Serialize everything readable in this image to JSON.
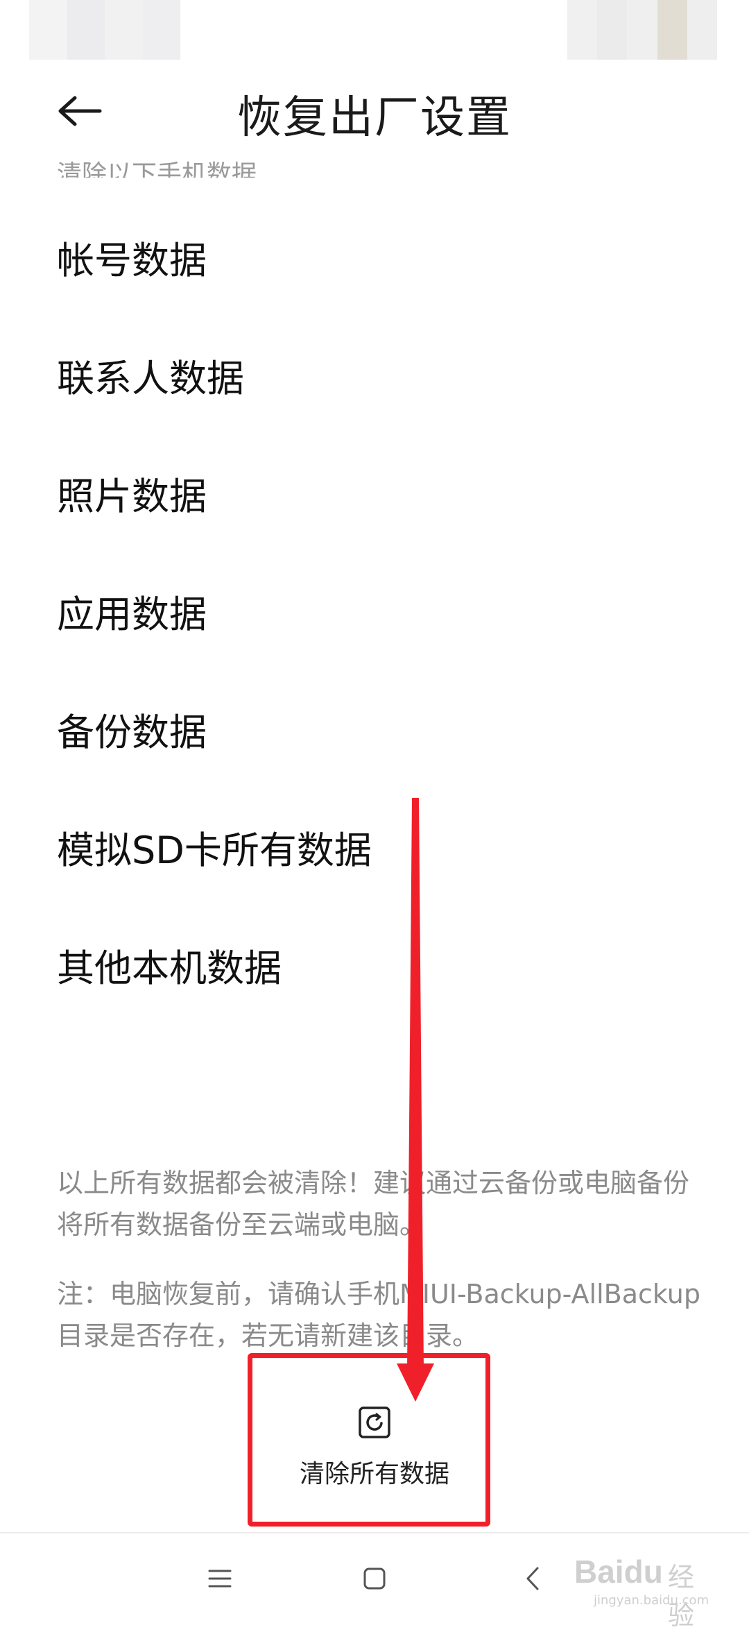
{
  "header": {
    "title": "恢复出厂设置",
    "partial_subtitle": "清除以下手机数据"
  },
  "list": {
    "items": [
      {
        "label": "帐号数据"
      },
      {
        "label": "联系人数据"
      },
      {
        "label": "照片数据"
      },
      {
        "label": "应用数据"
      },
      {
        "label": "备份数据"
      },
      {
        "label": "模拟SD卡所有数据"
      },
      {
        "label": "其他本机数据"
      }
    ]
  },
  "notes": {
    "warning": "以上所有数据都会被清除！建议通过云备份或电脑备份将所有数据备份至云端或电脑。",
    "note": "注：电脑恢复前，请确认手机MIUI-Backup-AllBackup目录是否存在，若无请新建该目录。"
  },
  "action": {
    "clear_all_label": "清除所有数据",
    "icon": "reset-icon"
  },
  "annotation": {
    "color": "#f0202a"
  },
  "navbar": {
    "icons": [
      "menu-icon",
      "home-icon",
      "back-icon"
    ]
  },
  "watermark": {
    "brand": "Bai",
    "brand_suffix": "du",
    "cn": "经验",
    "url": "jingyan.baidu.com"
  }
}
